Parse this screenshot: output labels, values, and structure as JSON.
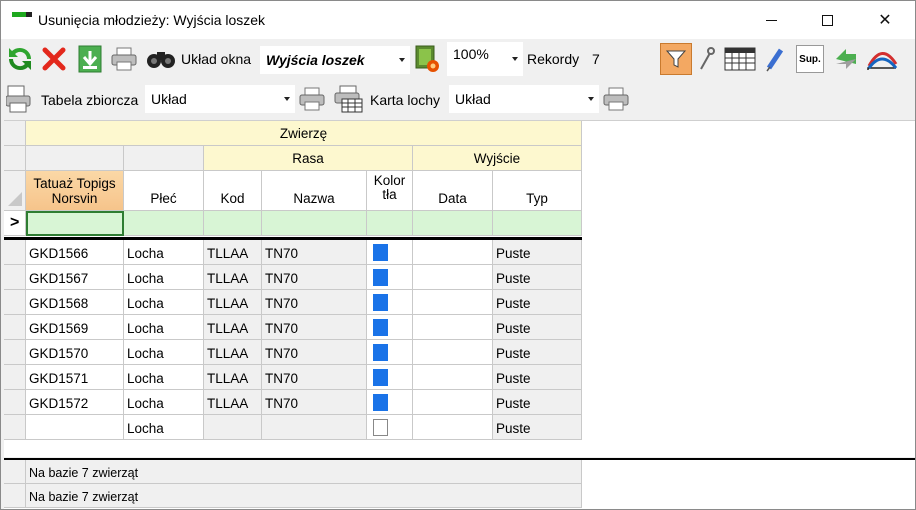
{
  "window": {
    "title": "Usunięcia młodzieży: Wyjścia loszek"
  },
  "toolbar1": {
    "layout_label": "Układ okna",
    "layout_value": "Wyjścia loszek",
    "zoom_value": "100%",
    "records_label": "Rekordy",
    "records_value": "7"
  },
  "toolbar2": {
    "summary_table_label": "Tabela zbiorcza",
    "summary_layout_value": "Układ",
    "sow_card_label": "Karta lochy",
    "sow_card_layout_value": "Układ"
  },
  "grid": {
    "group_header": "Zwierzę",
    "breed_group": "Rasa",
    "exit_group": "Wyjście",
    "columns": {
      "tattoo": "Tatuaż Topigs Norsvin",
      "sex": "Płeć",
      "code": "Kod",
      "name": "Nazwa",
      "color": "Kolor tła",
      "date": "Data",
      "type": "Typ"
    },
    "new_row_marker": ">",
    "rows": [
      {
        "tattoo": "GKD1566",
        "sex": "Locha",
        "code": "TLLAA",
        "name": "TN70",
        "color": "#1a73e8",
        "date": "",
        "type": "Puste"
      },
      {
        "tattoo": "GKD1567",
        "sex": "Locha",
        "code": "TLLAA",
        "name": "TN70",
        "color": "#1a73e8",
        "date": "",
        "type": "Puste"
      },
      {
        "tattoo": "GKD1568",
        "sex": "Locha",
        "code": "TLLAA",
        "name": "TN70",
        "color": "#1a73e8",
        "date": "",
        "type": "Puste"
      },
      {
        "tattoo": "GKD1569",
        "sex": "Locha",
        "code": "TLLAA",
        "name": "TN70",
        "color": "#1a73e8",
        "date": "",
        "type": "Puste"
      },
      {
        "tattoo": "GKD1570",
        "sex": "Locha",
        "code": "TLLAA",
        "name": "TN70",
        "color": "#1a73e8",
        "date": "",
        "type": "Puste"
      },
      {
        "tattoo": "GKD1571",
        "sex": "Locha",
        "code": "TLLAA",
        "name": "TN70",
        "color": "#1a73e8",
        "date": "",
        "type": "Puste"
      },
      {
        "tattoo": "GKD1572",
        "sex": "Locha",
        "code": "TLLAA",
        "name": "TN70",
        "color": "#1a73e8",
        "date": "",
        "type": "Puste"
      },
      {
        "tattoo": "",
        "sex": "Locha",
        "code": "",
        "name": "",
        "color": "#ffffff",
        "date": "",
        "type": "Puste"
      }
    ]
  },
  "totals": [
    "Na bazie 7 zwierząt",
    "Na bazie 7 zwierząt"
  ]
}
